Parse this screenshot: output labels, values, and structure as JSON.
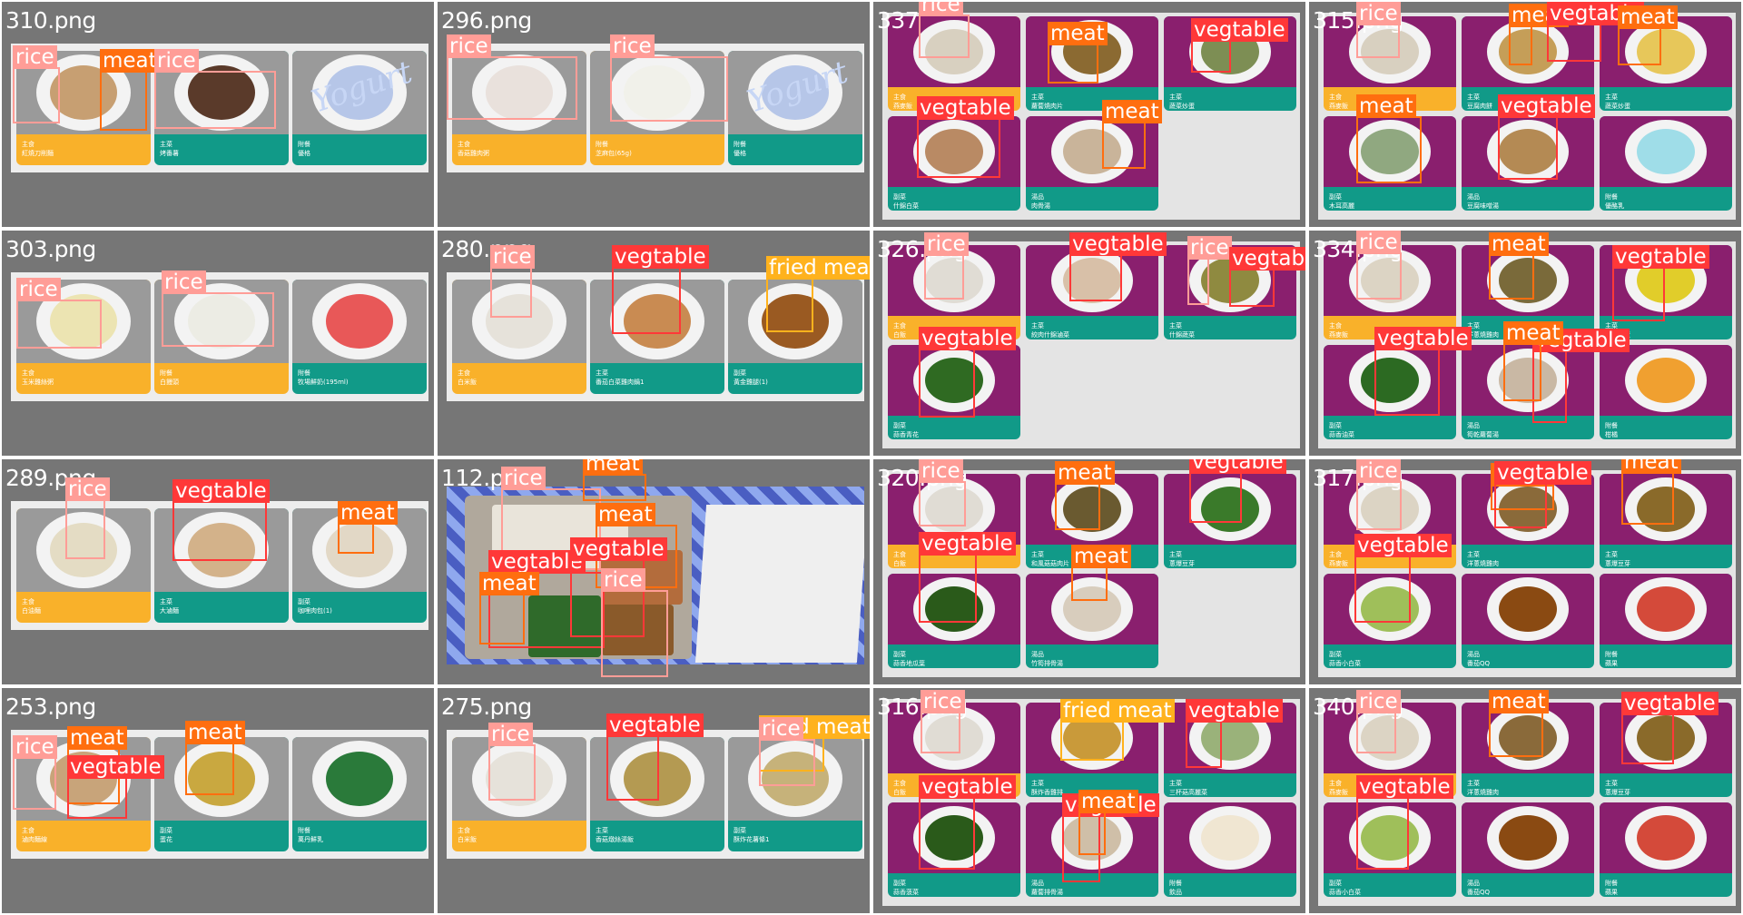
{
  "colors": {
    "rice": "#ff9d97",
    "meat": "#ff6e0f",
    "vegtable": "#ff3838",
    "fried meat": "#ffb21d",
    "caption_staple": "#f9b12a",
    "caption_dish": "#119a88"
  },
  "tiles": [
    {
      "name": "310.png",
      "cells": [
        {
          "k": "主食",
          "v": "紅燒刀削麵",
          "food": "#c79f72"
        },
        {
          "k": "主菜",
          "v": "烤番薯",
          "food": "#5a3a2a"
        },
        {
          "k": "附餐",
          "v": "優格",
          "food": "#b6c6e8"
        }
      ],
      "dets": [
        {
          "cls": "rice",
          "text": "rice"
        },
        {
          "cls": "meat",
          "text": "meat"
        },
        {
          "cls": "rice",
          "text": "rice"
        }
      ]
    },
    {
      "name": "296.png",
      "cells": [
        {
          "k": "主食",
          "v": "香菇雞肉粥",
          "food": "#e9e1dc"
        },
        {
          "k": "附餐",
          "v": "芝麻包(65g)",
          "food": "#f1f1ea"
        },
        {
          "k": "附餐",
          "v": "優格",
          "food": "#b6c6e8"
        }
      ],
      "dets": [
        {
          "cls": "rice",
          "text": "rice"
        },
        {
          "cls": "rice",
          "text": "rice"
        }
      ]
    },
    {
      "name": "337",
      "cells": [
        {
          "k": "主食",
          "v": "燕麥飯",
          "food": "#d8d0c0"
        },
        {
          "k": "主菜",
          "v": "蘿蔔燒肉片",
          "food": "#8b6a32"
        },
        {
          "k": "主菜",
          "v": "蔬菜炒蛋",
          "food": "#7d8e54"
        },
        {
          "k": "副菜",
          "v": "什錦白菜",
          "food": "#b98a64"
        },
        {
          "k": "湯品",
          "v": "肉骨湯",
          "food": "#c9b49a"
        }
      ],
      "dets": [
        {
          "cls": "rice",
          "text": "rice"
        },
        {
          "cls": "meat",
          "text": "meat"
        },
        {
          "cls": "vegtable",
          "text": "vegtable"
        },
        {
          "cls": "vegtable",
          "text": "vegtable"
        },
        {
          "cls": "meat",
          "text": "meat"
        }
      ]
    },
    {
      "name": "315.png",
      "cells": [
        {
          "k": "主食",
          "v": "燕麥飯",
          "food": "#d8d0c0"
        },
        {
          "k": "主菜",
          "v": "豆腐肉餅",
          "food": "#c59e58"
        },
        {
          "k": "主菜",
          "v": "蔬菜炒蛋",
          "food": "#e7c75a"
        },
        {
          "k": "副菜",
          "v": "木耳高麗",
          "food": "#90a880"
        },
        {
          "k": "湯品",
          "v": "豆腐味噌湯",
          "food": "#b48a54"
        },
        {
          "k": "附餐",
          "v": "優酪乳",
          "food": "#9fdde8"
        }
      ],
      "dets": [
        {
          "cls": "rice",
          "text": "rice"
        },
        {
          "cls": "meat",
          "text": "meat"
        },
        {
          "cls": "vegtable",
          "text": "vegtable"
        },
        {
          "cls": "meat",
          "text": "meat"
        },
        {
          "cls": "vegtable",
          "text": "vegtable"
        },
        {
          "cls": "meat",
          "text": "meat"
        }
      ]
    },
    {
      "name": "303.png",
      "cells": [
        {
          "k": "主食",
          "v": "玉米雞絲粥",
          "food": "#ece4b2"
        },
        {
          "k": "附餐",
          "v": "白饅頭",
          "food": "#ecece4"
        },
        {
          "k": "附餐",
          "v": "牧場鮮奶(195ml)",
          "food": "#e85858"
        }
      ],
      "dets": [
        {
          "cls": "rice",
          "text": "rice"
        },
        {
          "cls": "rice",
          "text": "rice"
        }
      ]
    },
    {
      "name": "280.png",
      "cells": [
        {
          "k": "主食",
          "v": "白米飯",
          "food": "#e6e2da"
        },
        {
          "k": "主菜",
          "v": "番茄白菜雞肉鍋1",
          "food": "#c98b52"
        },
        {
          "k": "副菜",
          "v": "黃金雞腿(1)",
          "food": "#9a5a22"
        }
      ],
      "dets": [
        {
          "cls": "rice",
          "text": "rice"
        },
        {
          "cls": "vegtable",
          "text": "vegtable"
        },
        {
          "cls": "fried meat",
          "text": "fried meat"
        }
      ]
    },
    {
      "name": "326.png",
      "cells": [
        {
          "k": "主食",
          "v": "白飯",
          "food": "#e0dcd4"
        },
        {
          "k": "主菜",
          "v": "絞肉什錦滷菜",
          "food": "#d8c0a8"
        },
        {
          "k": "主菜",
          "v": "什錦蔬菜",
          "food": "#8f8a40"
        },
        {
          "k": "副菜",
          "v": "蒜香青花",
          "food": "#2f6a22"
        }
      ],
      "dets": [
        {
          "cls": "rice",
          "text": "rice"
        },
        {
          "cls": "vegtable",
          "text": "vegtable"
        },
        {
          "cls": "rice",
          "text": "rice"
        },
        {
          "cls": "vegtable",
          "text": "vegtable"
        },
        {
          "cls": "vegtable",
          "text": "vegtable"
        }
      ]
    },
    {
      "name": "334.png",
      "cells": [
        {
          "k": "主食",
          "v": "燕麥飯",
          "food": "#dcd4c4"
        },
        {
          "k": "主菜",
          "v": "洋蔥燒雞肉",
          "food": "#7a6a3a"
        },
        {
          "k": "主菜",
          "v": "玉米炒蛋",
          "food": "#e1cd2a"
        },
        {
          "k": "副菜",
          "v": "蒜香油菜",
          "food": "#2c6a22"
        },
        {
          "k": "湯品",
          "v": "筍乾蘿蔔湯",
          "food": "#c9b8a4"
        },
        {
          "k": "附餐",
          "v": "柑橘",
          "food": "#f0a030"
        }
      ],
      "dets": [
        {
          "cls": "rice",
          "text": "rice"
        },
        {
          "cls": "meat",
          "text": "meat"
        },
        {
          "cls": "vegtable",
          "text": "vegtable"
        },
        {
          "cls": "vegtable",
          "text": "vegtable"
        },
        {
          "cls": "vegtable",
          "text": "vegtable"
        },
        {
          "cls": "meat",
          "text": "meat"
        }
      ]
    },
    {
      "name": "289.png",
      "cells": [
        {
          "k": "主食",
          "v": "白油麵",
          "food": "#e4dcc4"
        },
        {
          "k": "主菜",
          "v": "大滷麵",
          "food": "#d3b28a"
        },
        {
          "k": "副菜",
          "v": "咖哩肉包(1)",
          "food": "#e2d8c6"
        }
      ],
      "dets": [
        {
          "cls": "rice",
          "text": "rice"
        },
        {
          "cls": "vegtable",
          "text": "vegtable"
        },
        {
          "cls": "meat",
          "text": "meat"
        }
      ]
    },
    {
      "name": "112.png",
      "cells": [],
      "dets": [
        {
          "cls": "rice",
          "text": "rice"
        },
        {
          "cls": "meat",
          "text": "meat"
        },
        {
          "cls": "meat",
          "text": "meat"
        },
        {
          "cls": "vegtable",
          "text": "vegtable"
        },
        {
          "cls": "vegtable",
          "text": "vegtable"
        },
        {
          "cls": "rice",
          "text": "rice"
        },
        {
          "cls": "meat",
          "text": "meat"
        }
      ]
    },
    {
      "name": "320.png",
      "cells": [
        {
          "k": "主食",
          "v": "白飯",
          "food": "#e0dcd4"
        },
        {
          "k": "主菜",
          "v": "和風菇菇肉片",
          "food": "#6a5a30"
        },
        {
          "k": "主菜",
          "v": "蔥爆豆芽",
          "food": "#3a7a2a"
        },
        {
          "k": "副菜",
          "v": "蒜香地瓜葉",
          "food": "#2a5a1a"
        },
        {
          "k": "湯品",
          "v": "竹筍排骨湯",
          "food": "#d8cdbd"
        }
      ],
      "dets": [
        {
          "cls": "rice",
          "text": "rice"
        },
        {
          "cls": "meat",
          "text": "meat"
        },
        {
          "cls": "vegtable",
          "text": "vegtable"
        },
        {
          "cls": "vegtable",
          "text": "vegtable"
        },
        {
          "cls": "meat",
          "text": "meat"
        }
      ]
    },
    {
      "name": "317.png",
      "cells": [
        {
          "k": "主食",
          "v": "燕麥飯",
          "food": "#dcd4c4"
        },
        {
          "k": "主菜",
          "v": "洋蔥燒雞肉",
          "food": "#8a6a3a"
        },
        {
          "k": "主菜",
          "v": "蔥爆豆芽",
          "food": "#8a6a2a"
        },
        {
          "k": "副菜",
          "v": "蒜香小白菜",
          "food": "#9fbf5a"
        },
        {
          "k": "湯品",
          "v": "番茄QQ",
          "food": "#8a4a12"
        },
        {
          "k": "附餐",
          "v": "蘋果",
          "food": "#d44a3a"
        }
      ],
      "dets": [
        {
          "cls": "rice",
          "text": "rice"
        },
        {
          "cls": "meat",
          "text": "meat"
        },
        {
          "cls": "meat",
          "text": "meat"
        },
        {
          "cls": "vegtable",
          "text": "vegtable"
        },
        {
          "cls": "vegtable",
          "text": "vegtable"
        }
      ]
    },
    {
      "name": "253.png",
      "cells": [
        {
          "k": "主食",
          "v": "滷肉麵線",
          "food": "#c8a47a"
        },
        {
          "k": "副菜",
          "v": "蛋花",
          "food": "#c9a840"
        },
        {
          "k": "附餐",
          "v": "萬丹鮮乳",
          "food": "#2a7a3a"
        }
      ],
      "dets": [
        {
          "cls": "rice",
          "text": "rice"
        },
        {
          "cls": "meat",
          "text": "meat"
        },
        {
          "cls": "vegtable",
          "text": "vegtable"
        },
        {
          "cls": "meat",
          "text": "meat"
        }
      ]
    },
    {
      "name": "275.png",
      "cells": [
        {
          "k": "主食",
          "v": "白米飯",
          "food": "#e6e2da"
        },
        {
          "k": "主菜",
          "v": "香菇燉絲湯飯",
          "food": "#b49a52"
        },
        {
          "k": "副菜",
          "v": "酥炸花薯條1",
          "food": "#c6b27a"
        }
      ],
      "dets": [
        {
          "cls": "rice",
          "text": "rice"
        },
        {
          "cls": "vegtable",
          "text": "vegtable"
        },
        {
          "cls": "fried meat",
          "text": "fried meat"
        },
        {
          "cls": "rice",
          "text": "rice"
        }
      ]
    },
    {
      "name": "316.png",
      "cells": [
        {
          "k": "主食",
          "v": "白飯",
          "food": "#e0dcd4"
        },
        {
          "k": "主菜",
          "v": "酥炸香雞排",
          "food": "#c99a3a"
        },
        {
          "k": "主菜",
          "v": "三杯菇高麗菜",
          "food": "#9ab27a"
        },
        {
          "k": "副菜",
          "v": "蒜香菠菜",
          "food": "#2a5a1a"
        },
        {
          "k": "湯品",
          "v": "蘿蔔排骨湯",
          "food": "#cfbfa8"
        },
        {
          "k": "附餐",
          "v": "飲品",
          "food": "#f0e6d2"
        }
      ],
      "dets": [
        {
          "cls": "rice",
          "text": "rice"
        },
        {
          "cls": "fried meat",
          "text": "fried meat"
        },
        {
          "cls": "vegtable",
          "text": "vegtable"
        },
        {
          "cls": "vegtable",
          "text": "vegtable"
        },
        {
          "cls": "vegtable",
          "text": "vegtable"
        },
        {
          "cls": "meat",
          "text": "meat"
        }
      ]
    },
    {
      "name": "340.png",
      "cells": [
        {
          "k": "主食",
          "v": "燕麥飯",
          "food": "#dcd4c4"
        },
        {
          "k": "主菜",
          "v": "洋蔥燒雞肉",
          "food": "#8a6a3a"
        },
        {
          "k": "主菜",
          "v": "蔥爆豆芽",
          "food": "#8a6a2a"
        },
        {
          "k": "副菜",
          "v": "蒜香小白菜",
          "food": "#9fbf5a"
        },
        {
          "k": "湯品",
          "v": "番茄QQ",
          "food": "#8a4a12"
        },
        {
          "k": "附餐",
          "v": "蘋果",
          "food": "#d44a3a"
        }
      ],
      "dets": [
        {
          "cls": "rice",
          "text": "rice"
        },
        {
          "cls": "meat",
          "text": "meat"
        },
        {
          "cls": "vegtable",
          "text": "vegtable"
        },
        {
          "cls": "vegtable",
          "text": "vegtable"
        }
      ]
    }
  ]
}
